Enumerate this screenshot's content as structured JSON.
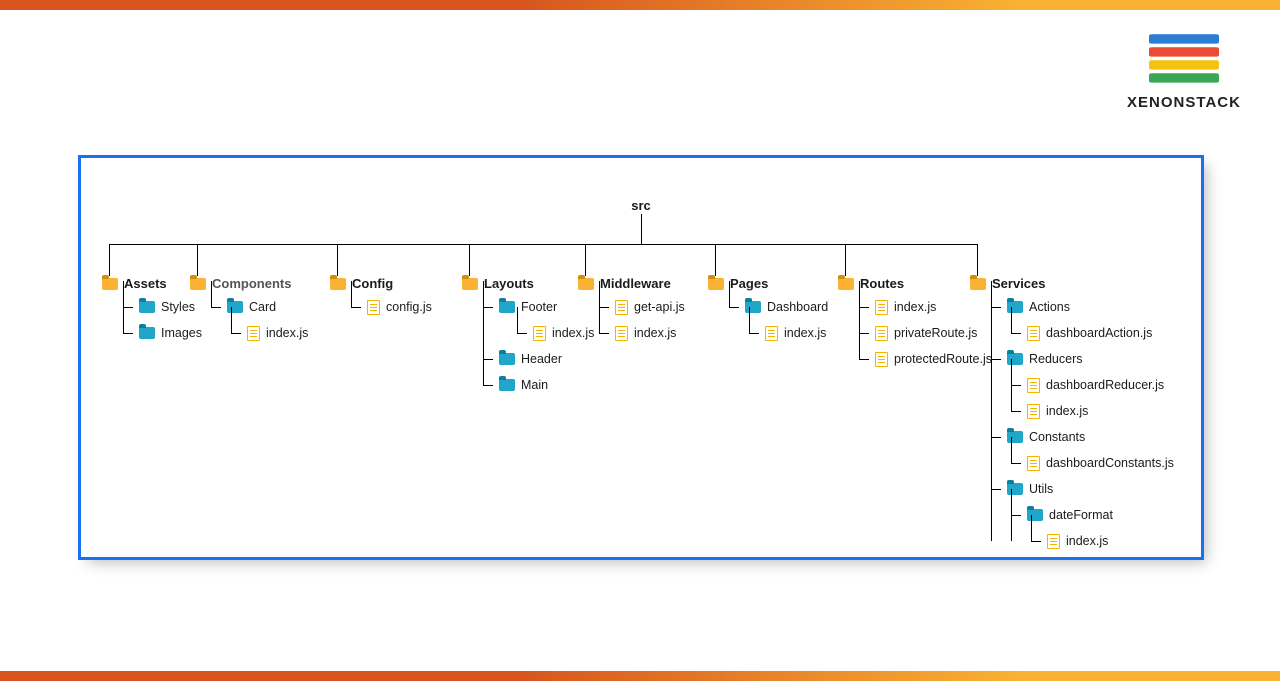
{
  "brand": {
    "name": "XENONSTACK"
  },
  "root": "src",
  "columns": {
    "assets": {
      "label": "Assets",
      "children": {
        "styles": "Styles",
        "images": "Images"
      }
    },
    "components": {
      "label": "Components",
      "children": {
        "card": "Card",
        "card_index": "index.js"
      }
    },
    "config": {
      "label": "Config",
      "children": {
        "config_file": "config.js"
      }
    },
    "layouts": {
      "label": "Layouts",
      "children": {
        "footer": "Footer",
        "footer_index": "index.js",
        "header": "Header",
        "main": "Main"
      }
    },
    "middleware": {
      "label": "Middleware",
      "children": {
        "get_api": "get-api.js",
        "index": "index.js"
      }
    },
    "pages": {
      "label": "Pages",
      "children": {
        "dashboard": "Dashboard",
        "dashboard_index": "index.js"
      }
    },
    "routes": {
      "label": "Routes",
      "children": {
        "index": "index.js",
        "private": "privateRoute.js",
        "protected": "protectedRoute.js"
      }
    },
    "services": {
      "label": "Services",
      "children": {
        "actions": "Actions",
        "actions_file": "dashboardAction.js",
        "reducers": "Reducers",
        "reducers_file": "dashboardReducer.js",
        "reducers_index": "index.js",
        "constants": "Constants",
        "constants_file": "dashboardConstants.js",
        "utils": "Utils",
        "utils_dateformat": "dateFormat",
        "utils_index": "index.js"
      }
    }
  }
}
